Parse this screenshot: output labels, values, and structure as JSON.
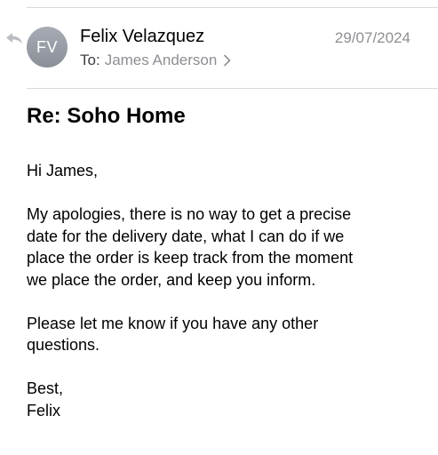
{
  "message": {
    "avatar_initials": "FV",
    "sender": "Felix Velazquez",
    "date": "29/07/2024",
    "to_label": "To:",
    "recipient": "James Anderson",
    "subject": "Re: Soho Home",
    "greeting": "Hi James,",
    "para1_line1": "My apologies, there is no way to get a precise",
    "para1_line2": "date for the delivery date, what I can do if we",
    "para1_line3": "place the order is keep track from the moment",
    "para1_line4": "we place the order, and keep you inform.",
    "para2_line1": "Please let me know if you have any other",
    "para2_line2": "questions.",
    "signoff": "Best,",
    "signature": "Felix"
  },
  "icons": {
    "reply": "reply-arrow-icon",
    "recipient_chevron": "chevron-right-icon"
  },
  "colors": {
    "secondary_text": "#8e8e93",
    "avatar_bg": "#9a9ea7",
    "divider": "#d9d9d9"
  }
}
